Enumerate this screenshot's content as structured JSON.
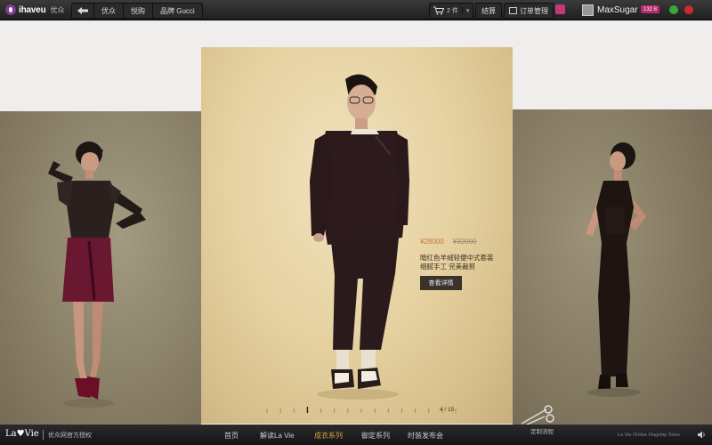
{
  "topbar": {
    "logo_text": "ihaveu",
    "logo_sub": "优众",
    "nav": [
      "优众",
      "悦购",
      "品牌 Gucci"
    ],
    "cart_count": "2 件",
    "checkout": "结算",
    "orders": "订单管理",
    "username": "MaxSugar",
    "points": "132 8"
  },
  "product": {
    "price_now": "¥28000",
    "price_old": "¥32000",
    "desc_line1": "暗红色羊绒轻便中式套装",
    "desc_line2": "细腻手工  完美裁剪",
    "detail_button": "查看详情",
    "pager": "4 / 15",
    "page_current": 4,
    "page_total": 15
  },
  "bottombar": {
    "brand": "La♥Vie",
    "authorization": "优众网官方授权",
    "nav": [
      {
        "label": "首页",
        "active": false
      },
      {
        "label": "解读La Vie",
        "active": false
      },
      {
        "label": "成衣系列",
        "active": true
      },
      {
        "label": "御定系列",
        "active": false
      },
      {
        "label": "时装发布会",
        "active": false
      }
    ],
    "custom_process": "定制流程",
    "flagship": "La Vie Online Flagship Store"
  },
  "colors": {
    "accent_gold": "#d6a24c",
    "price_orange": "#c3782a",
    "brand_purple": "#7b3d8f"
  }
}
